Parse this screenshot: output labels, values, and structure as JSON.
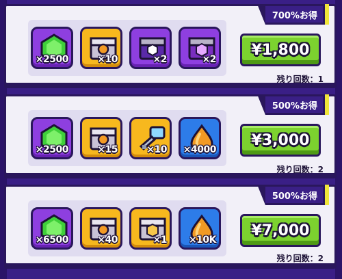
{
  "colors": {
    "background": "#3a1f86",
    "card": "#f2f0f8",
    "price_button": "#7cd22f",
    "badge_accent": "#f0e53a"
  },
  "offers": [
    {
      "badge": "700%お得",
      "price": "¥1,800",
      "remaining": "残り回数：1",
      "items": [
        {
          "icon": "green-gem-icon",
          "qty": "×2500",
          "tile": "purple"
        },
        {
          "icon": "gold-chest-icon",
          "qty": "×10",
          "tile": "gold"
        },
        {
          "icon": "purple-chest-icon",
          "qty": "×2",
          "tile": "purple"
        },
        {
          "icon": "purple-hex-chest-icon",
          "qty": "×2",
          "tile": "purple"
        }
      ]
    },
    {
      "badge": "500%お得",
      "price": "¥3,000",
      "remaining": "残り回数：2",
      "items": [
        {
          "icon": "green-gem-icon",
          "qty": "×2500",
          "tile": "purple"
        },
        {
          "icon": "gold-chest-icon",
          "qty": "×15",
          "tile": "gold"
        },
        {
          "icon": "key-icon",
          "qty": "×10",
          "tile": "gold"
        },
        {
          "icon": "orange-drop-icon",
          "qty": "×4000",
          "tile": "blue"
        }
      ]
    },
    {
      "badge": "500%お得",
      "price": "¥7,000",
      "remaining": "残り回数：2",
      "items": [
        {
          "icon": "green-gem-icon",
          "qty": "×6500",
          "tile": "purple"
        },
        {
          "icon": "gold-chest-icon",
          "qty": "×40",
          "tile": "gold"
        },
        {
          "icon": "gold-hex-chest-icon",
          "qty": "×1",
          "tile": "gold"
        },
        {
          "icon": "orange-drop-icon",
          "qty": "×10K",
          "tile": "blue"
        }
      ]
    }
  ]
}
